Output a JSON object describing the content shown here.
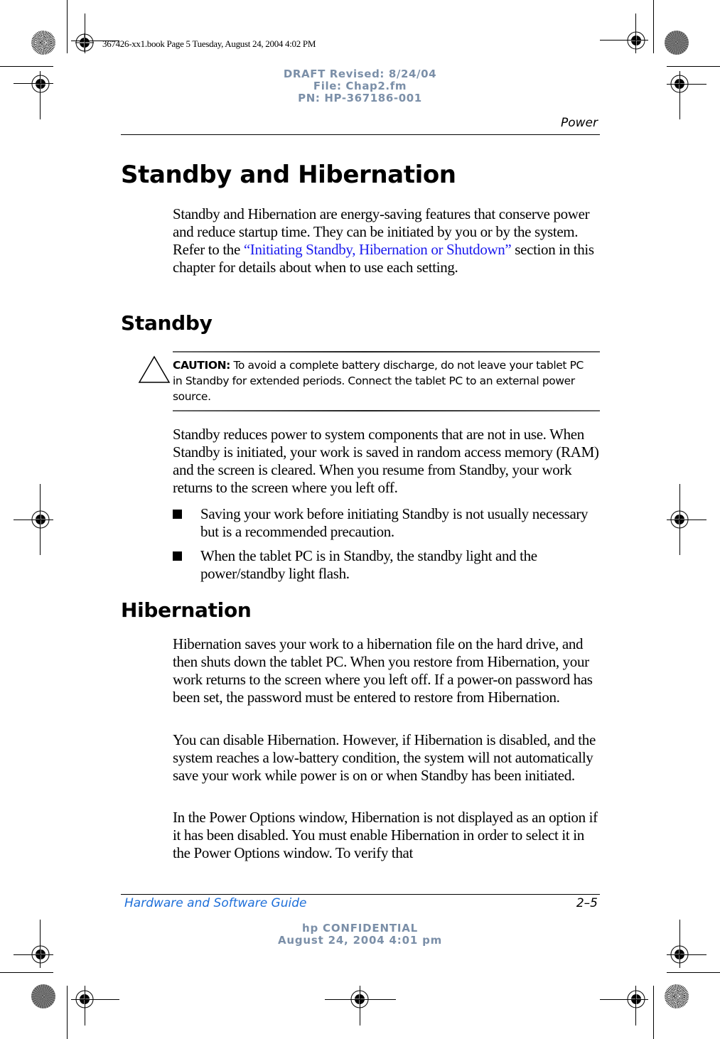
{
  "print_marks": {
    "book_info": "367426-xx1.book  Page 5  Tuesday, August 24, 2004  4:02 PM"
  },
  "draft_stamp": {
    "line1": "DRAFT Revised: 8/24/04",
    "line2": "File: Chap2.fm",
    "line3": "PN: HP-367186-001"
  },
  "header": {
    "running_head": "Power"
  },
  "section": {
    "title": "Standby and Hibernation",
    "intro": {
      "text_before_link": "Standby and Hibernation are energy-saving features that conserve power and reduce startup time. They can be initiated by you or by the system. Refer to the ",
      "link": "“Initiating Standby, Hibernation or Shutdown”",
      "text_after_link": " section in this chapter for details about when to use each setting."
    }
  },
  "standby": {
    "heading": "Standby",
    "caution": {
      "label": "CAUTION:",
      "text": " To avoid a complete battery discharge, do not leave your tablet PC in Standby for extended periods. Connect the tablet PC to an external power source."
    },
    "paragraph": "Standby reduces power to system components that are not in use. When Standby is initiated, your work is saved in random access memory (RAM) and the screen is cleared. When you resume from Standby, your work returns to the screen where you left off.",
    "bullets": [
      "Saving your work before initiating Standby is not usually necessary but is a recommended precaution.",
      "When the tablet PC is in Standby, the standby light and the power/standby light flash."
    ]
  },
  "hibernation": {
    "heading": "Hibernation",
    "paragraphs": [
      "Hibernation saves your work to a hibernation file on the hard drive, and then shuts down the tablet PC. When you restore from Hibernation, your work returns to the screen where you left off. If a power-on password has been set, the password must be entered to restore from Hibernation.",
      "You can disable Hibernation. However, if Hibernation is disabled, and the system reaches a low-battery condition, the system will not automatically save your work while power is on or when Standby has been initiated.",
      "In the Power Options window, Hibernation is not displayed as an option if it has been disabled. You must enable Hibernation in order to select it in the Power Options window. To verify that"
    ]
  },
  "footer": {
    "guide_title": "Hardware and Software Guide",
    "page_number": "2–5",
    "confidential_line1": "hp CONFIDENTIAL",
    "confidential_line2": "August 24, 2004 4:01 pm"
  },
  "colors": {
    "link": "#1a1aee",
    "footer_title": "#1e6fd9",
    "draft_stamp": "#7b8fa8"
  }
}
